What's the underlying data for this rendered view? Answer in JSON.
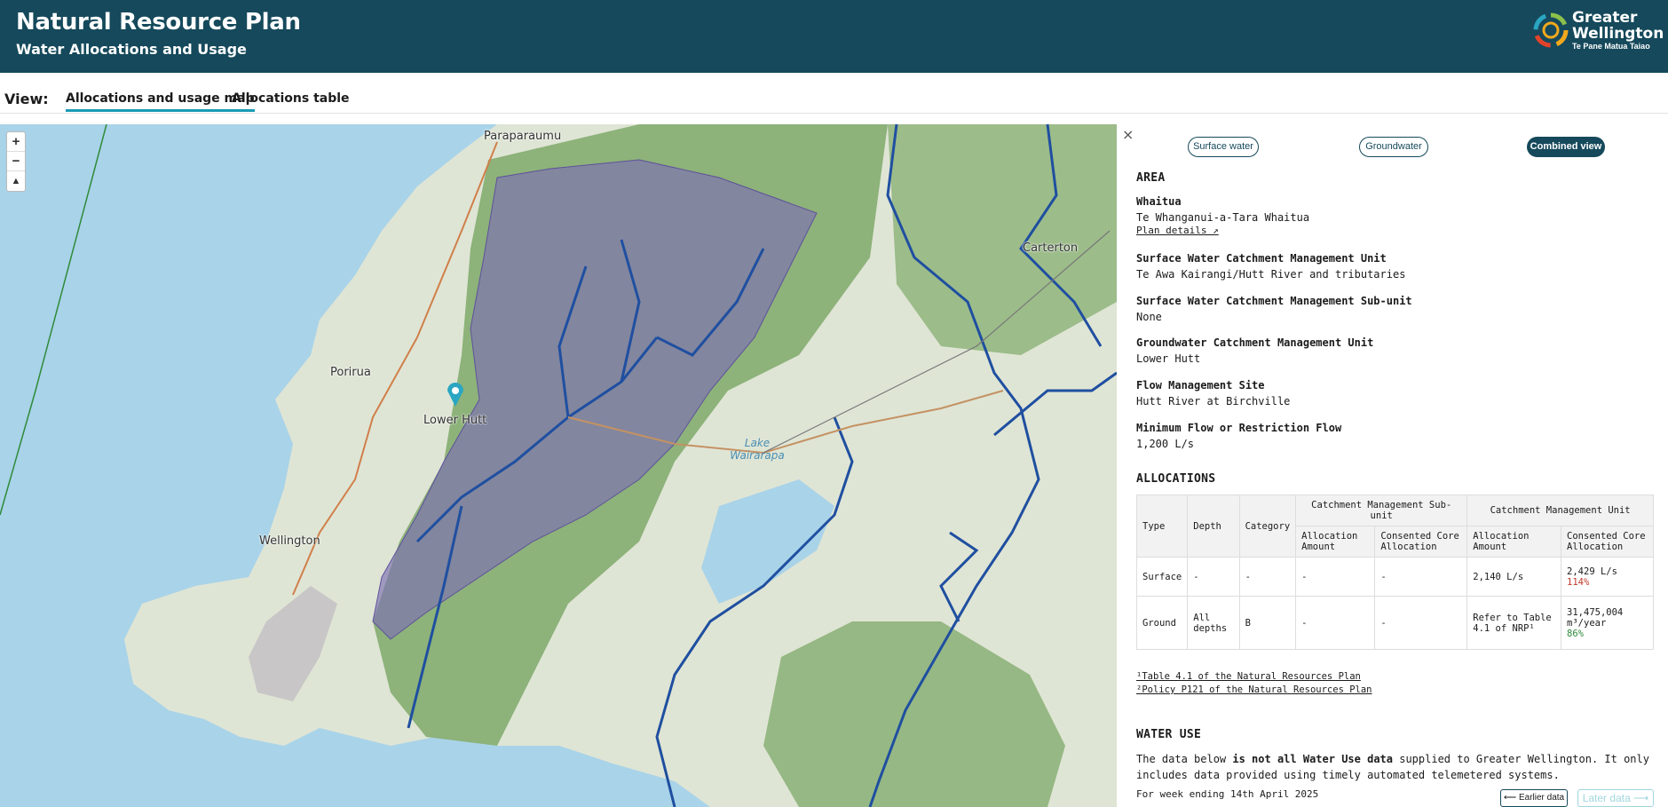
{
  "header": {
    "title": "Natural Resource Plan",
    "subtitle": "Water Allocations and Usage",
    "logo": {
      "line1": "Greater",
      "line2": "Wellington",
      "line3": "Te Pane Matua Taiao"
    }
  },
  "viewbar": {
    "label": "View:",
    "tabs": [
      {
        "label": "Allocations and usage map",
        "active": true
      },
      {
        "label": "Allocations table",
        "active": false
      }
    ]
  },
  "map": {
    "zoom_in": "+",
    "zoom_out": "−",
    "compass": "▲",
    "places": [
      "Paraparaumu",
      "Carterton",
      "Porirua",
      "Lower Hutt",
      "Wellington",
      "Lake Wairarapa"
    ],
    "colors": {
      "sea": "#a9d3e8",
      "catchment": "#7c6fb3",
      "river": "#1f4fa0"
    }
  },
  "panel": {
    "close": "×",
    "pills": [
      {
        "label": "Surface water",
        "active": false
      },
      {
        "label": "Groundwater",
        "active": false
      },
      {
        "label": "Combined view",
        "active": true
      }
    ],
    "area_heading": "AREA",
    "whaitua": {
      "key": "Whaitua",
      "value": "Te Whanganui-a-Tara Whaitua",
      "link": "Plan details ↗"
    },
    "sw_cmu": {
      "key": "Surface Water Catchment Management Unit",
      "value": "Te Awa Kairangi/Hutt River and tributaries"
    },
    "sw_sub": {
      "key": "Surface Water Catchment Management Sub-unit",
      "value": "None"
    },
    "gw_cmu": {
      "key": "Groundwater Catchment Management Unit",
      "value": "Lower Hutt"
    },
    "flow_site": {
      "key": "Flow Management Site",
      "value": "Hutt River at Birchville"
    },
    "min_flow": {
      "key": "Minimum Flow or Restriction Flow",
      "value": "1,200 L/s"
    },
    "alloc_heading": "ALLOCATIONS",
    "table": {
      "h_type": "Type",
      "h_depth": "Depth",
      "h_category": "Category",
      "h_sub": "Catchment Management Sub-unit",
      "h_unit": "Catchment Management Unit",
      "h_alloc_amount": "Allocation Amount",
      "h_consented": "Consented Core Allocation",
      "rows": [
        {
          "type": "Surface",
          "depth": "-",
          "category": "-",
          "sub_alloc": "-",
          "sub_cons": "-",
          "unit_alloc": "2,140 L/s",
          "unit_cons": "2,429 L/s",
          "unit_cons_pct": "114%"
        },
        {
          "type": "Ground",
          "depth": "All depths",
          "category": "B",
          "sub_alloc": "-",
          "sub_cons": "-",
          "unit_alloc": "Refer to Table 4.1 of NRP¹",
          "unit_cons": "31,475,004 m³/year",
          "unit_cons_pct": "86%"
        }
      ]
    },
    "notes": [
      "¹Table 4.1 of the Natural Resources Plan",
      "²Policy P121 of the Natural Resources Plan"
    ],
    "use_heading": "WATER USE",
    "use_text_1": "The data below ",
    "use_text_bold": "is not all Water Use data",
    "use_text_2": " supplied to Greater Wellington. It only includes data provided using timely automated telemetered systems.",
    "week": "For week ending 14th April 2025",
    "earlier": "⟵ Earlier data",
    "later": "Later data ⟶"
  }
}
